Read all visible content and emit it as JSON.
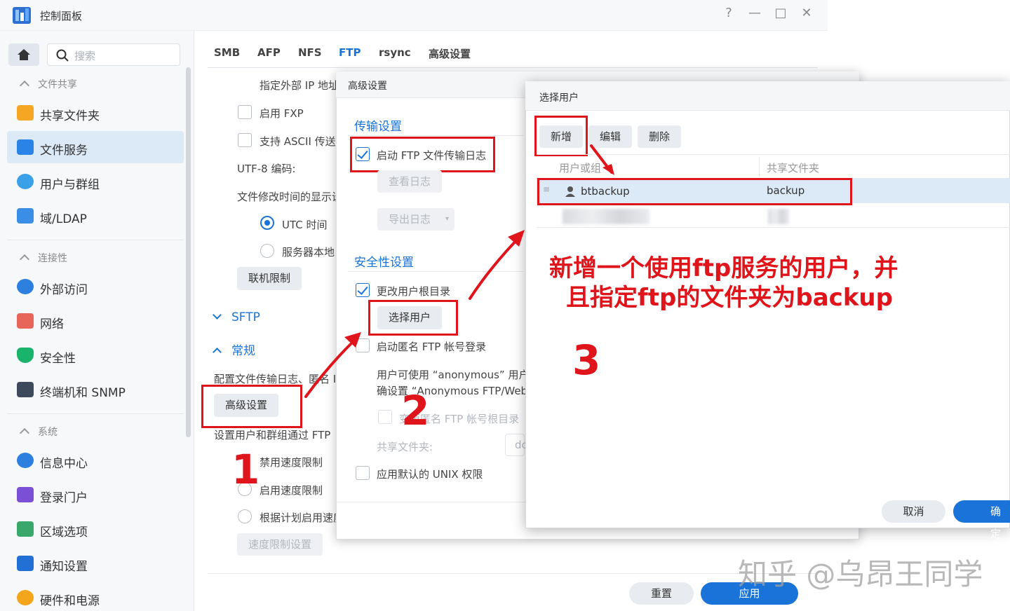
{
  "window": {
    "title": "控制面板",
    "controls": [
      "?",
      "—",
      "□",
      "✕"
    ]
  },
  "sidebar": {
    "search_placeholder": "搜索",
    "sections": [
      {
        "label": "文件共享",
        "items": [
          "共享文件夹",
          "文件服务",
          "用户与群组",
          "域/LDAP"
        ]
      },
      {
        "label": "连接性",
        "items": [
          "外部访问",
          "网络",
          "安全性",
          "终端机和 SNMP"
        ]
      },
      {
        "label": "系统",
        "items": [
          "信息中心",
          "登录门户",
          "区域选项",
          "通知设置",
          "硬件和电源"
        ]
      }
    ],
    "active_item": "文件服务"
  },
  "tabs": [
    "SMB",
    "AFP",
    "NFS",
    "FTP",
    "rsync",
    "高级设置"
  ],
  "active_tab": "FTP",
  "main": {
    "ext_ip": "指定外部 IP 地址",
    "fxp": "启用 FXP",
    "ascii": "支持 ASCII 传送",
    "utf8": "UTF-8 编码:",
    "time_display": "文件修改时间的显示设",
    "utc": "UTC 时间",
    "local": "服务器本地",
    "conn_limit": "联机限制",
    "sftp": "SFTP",
    "general": "常规",
    "config_text": "配置文件传输日志、匿名 I",
    "adv_btn": "高级设置",
    "set_users_text": "设置用户和群组通过 FTP",
    "disable_speed": "禁用速度限制",
    "enable_speed": "启用速度限制",
    "schedule_speed": "根据计划启用速度",
    "speed_settings": "速度限制设置",
    "reset": "重置",
    "apply": "应用"
  },
  "adv_dialog": {
    "title": "高级设置",
    "transfer_section": "传输设置",
    "enable_log": "启动 FTP 文件传输日志",
    "view_log": "查看日志",
    "export_log": "导出日志",
    "security_section": "安全性设置",
    "change_root": "更改用户根目录",
    "select_user": "选择用户",
    "anon_login": "启动匿名 FTP 帐号登录",
    "anon_desc1": "用户可使用 “anonymous” 用户",
    "anon_desc2": "确设置 “Anonymous FTP/Web",
    "anon_root": "变更匿名 FTP 帐号根目录",
    "shared_folder": "共享文件夹:",
    "shared_value": "dc",
    "unix_perm": "应用默认的 UNIX 权限"
  },
  "user_dialog": {
    "title": "选择用户",
    "add": "新增",
    "edit": "编辑",
    "delete": "删除",
    "col_user": "用户或组",
    "col_folder": "共享文件夹",
    "rows": [
      {
        "user": "btbackup",
        "folder": "backup"
      }
    ],
    "cancel": "取消",
    "ok": "确定"
  },
  "annotations": {
    "step1": "1",
    "step2": "2",
    "step3": "3",
    "note_line1": "新增一个使用ftp服务的用户，并",
    "note_line2": "且指定ftp的文件夹为backup"
  },
  "watermark": "知乎 @乌昂王同学",
  "colors": {
    "accent": "#1a73d8",
    "annotation": "#e0141b"
  }
}
